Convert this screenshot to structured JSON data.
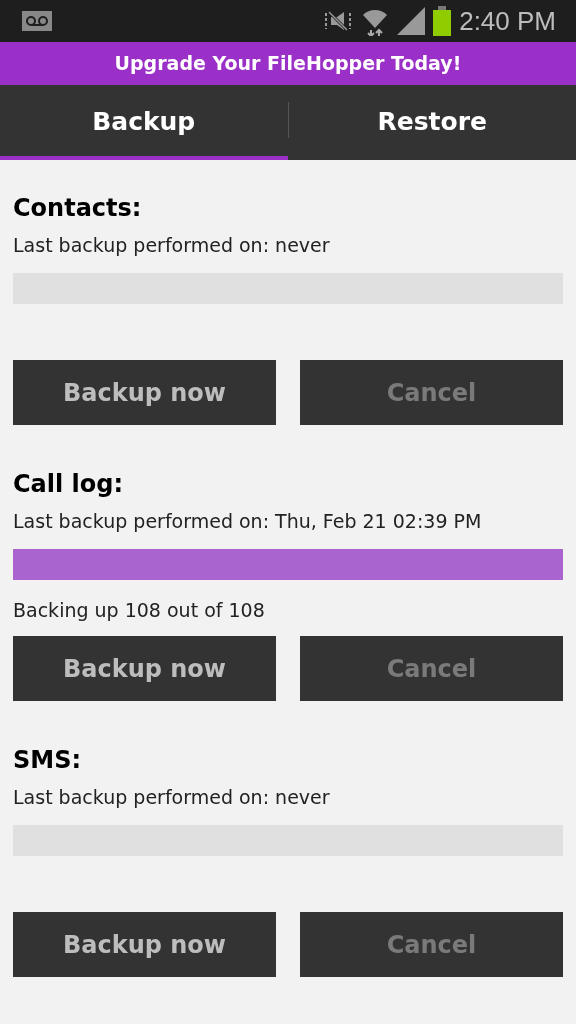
{
  "status_bar": {
    "time": "2:40 PM"
  },
  "banner": {
    "text": "Upgrade Your FileHopper Today!"
  },
  "tabs": [
    {
      "label": "Backup",
      "selected": true
    },
    {
      "label": "Restore",
      "selected": false
    }
  ],
  "sections": [
    {
      "title": "Contacts:",
      "last_backup": "Last backup performed on: never",
      "level": 0,
      "buttons": [
        {
          "label": "Backup now",
          "disabled": false
        },
        {
          "label": "Cancel",
          "disabled": true
        }
      ]
    },
    {
      "title": "Call log:",
      "last_backup": "Last backup performed on: Thu, Feb 21 02:39 PM",
      "level": 1,
      "progress_text": "Backing up 108 out of 108",
      "buttons": [
        {
          "label": "Backup now",
          "disabled": false
        },
        {
          "label": "Cancel",
          "disabled": true
        }
      ]
    },
    {
      "title": "SMS:",
      "last_backup": "Last backup performed on: never",
      "level": 0,
      "buttons": [
        {
          "label": "Backup now",
          "disabled": false
        },
        {
          "label": "Cancel",
          "disabled": true
        }
      ]
    }
  ]
}
